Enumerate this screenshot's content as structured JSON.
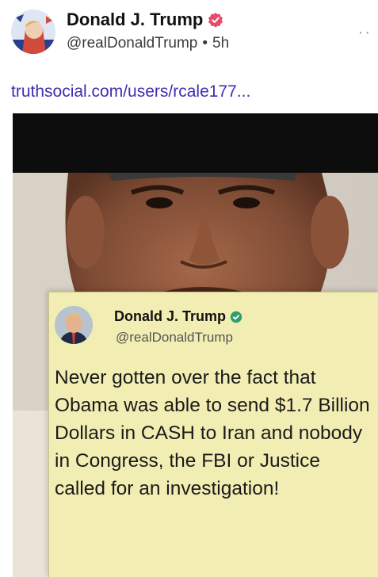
{
  "post": {
    "author_name": "Donald J. Trump",
    "handle": "@realDonaldTrump",
    "separator": "•",
    "time": "5h",
    "more_label": "··",
    "link_text": "truthsocial.com/users/rcale177..."
  },
  "quote": {
    "author_name": "Donald J. Trump",
    "handle": "@realDonaldTrump",
    "text": "Never gotten over the fact that Obama was able to send $1.7 Billion Dollars in CASH to Iran and nobody in Congress, the FBI or Justice called for an investigation!"
  },
  "icons": {
    "verified_post": "verified-badge-icon",
    "verified_quote": "verified-badge-icon",
    "more": "more-dots-icon"
  },
  "colors": {
    "link": "#3d2fb1",
    "verified_post": "#e84a6a",
    "verified_quote": "#2e9e6b",
    "card": "#f2eeb3"
  }
}
